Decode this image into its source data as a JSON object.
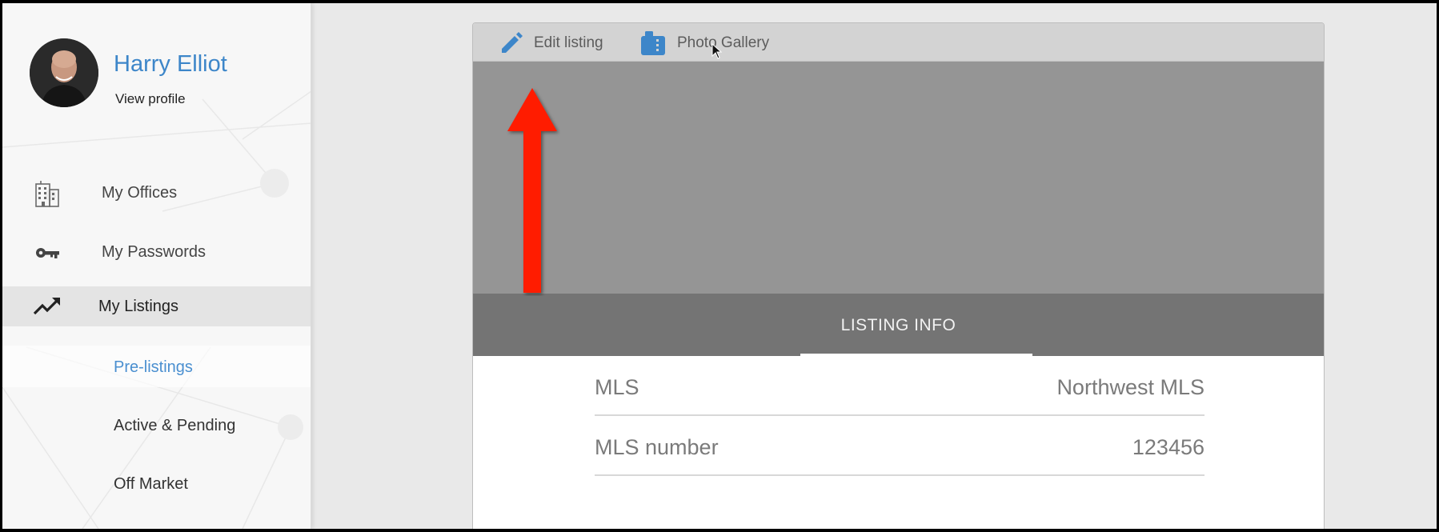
{
  "profile": {
    "name": "Harry Elliot",
    "link": "View profile"
  },
  "sidebar": {
    "items": [
      {
        "label": "My Offices",
        "icon": "building-icon"
      },
      {
        "label": "My Passwords",
        "icon": "key-icon"
      },
      {
        "label": "My Listings",
        "icon": "trending-up-icon",
        "active": true
      }
    ],
    "subitems": [
      {
        "label": "Pre-listings",
        "selected": true
      },
      {
        "label": "Active & Pending"
      },
      {
        "label": "Off Market"
      }
    ]
  },
  "toolbar": {
    "edit_label": "Edit listing",
    "gallery_label": "Photo Gallery"
  },
  "tab": {
    "label": "LISTING INFO"
  },
  "info": {
    "rows": [
      {
        "key": "MLS",
        "value": "Northwest MLS"
      },
      {
        "key": "MLS number",
        "value": "123456"
      }
    ]
  },
  "colors": {
    "accent": "#3d86c9",
    "arrow": "#ff1a00",
    "tabbar": "#747474",
    "photo_placeholder": "#959595"
  }
}
